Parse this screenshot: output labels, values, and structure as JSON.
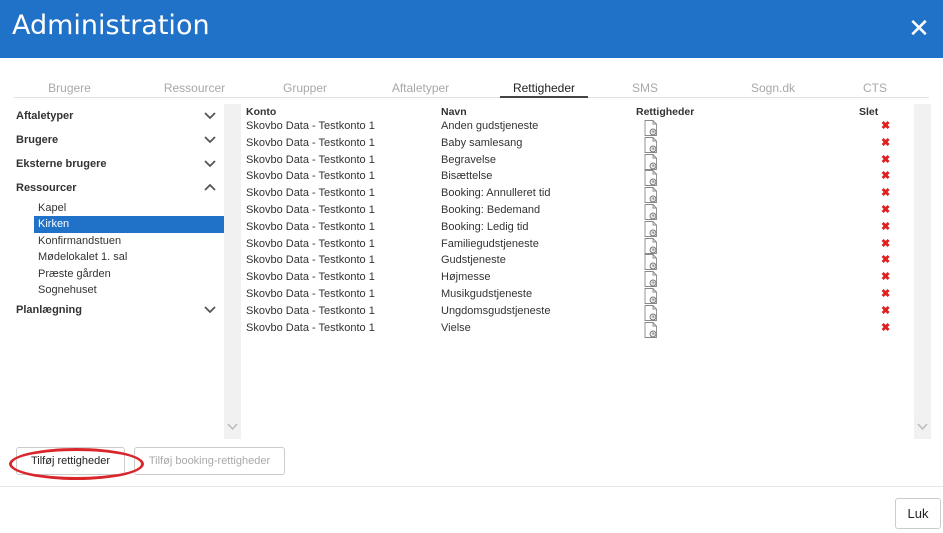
{
  "window": {
    "title": "Administration"
  },
  "tabs": [
    {
      "label": "Brugere",
      "active": false
    },
    {
      "label": "Ressourcer",
      "active": false
    },
    {
      "label": "Grupper",
      "active": false
    },
    {
      "label": "Aftaletyper",
      "active": false
    },
    {
      "label": "Rettigheder",
      "active": true
    },
    {
      "label": "SMS",
      "active": false
    },
    {
      "label": "Sogn.dk",
      "active": false
    },
    {
      "label": "CTS",
      "active": false
    }
  ],
  "sidebar": {
    "groups": [
      {
        "label": "Aftaletyper",
        "expanded": false
      },
      {
        "label": "Brugere",
        "expanded": false
      },
      {
        "label": "Eksterne brugere",
        "expanded": false
      },
      {
        "label": "Ressourcer",
        "expanded": true,
        "items": [
          "Kapel",
          "Kirken",
          "Konfirmandstuen",
          "Mødelokalet 1. sal",
          "Præste gården",
          "Sognehuset"
        ],
        "selected": "Kirken"
      },
      {
        "label": "Planlægning",
        "expanded": false
      }
    ]
  },
  "table": {
    "headers": {
      "konto": "Konto",
      "navn": "Navn",
      "rettigheder": "Rettigheder",
      "slet": "Slet"
    },
    "rows": [
      {
        "konto": "Skovbo Data - Testkonto 1",
        "navn": "Anden gudstjeneste"
      },
      {
        "konto": "Skovbo Data - Testkonto 1",
        "navn": "Baby samlesang"
      },
      {
        "konto": "Skovbo Data - Testkonto 1",
        "navn": "Begravelse"
      },
      {
        "konto": "Skovbo Data - Testkonto 1",
        "navn": "Bisættelse"
      },
      {
        "konto": "Skovbo Data - Testkonto 1",
        "navn": "Booking: Annulleret tid"
      },
      {
        "konto": "Skovbo Data - Testkonto 1",
        "navn": "Booking: Bedemand"
      },
      {
        "konto": "Skovbo Data - Testkonto 1",
        "navn": "Booking: Ledig tid"
      },
      {
        "konto": "Skovbo Data - Testkonto 1",
        "navn": "Familiegudstjeneste"
      },
      {
        "konto": "Skovbo Data - Testkonto 1",
        "navn": "Gudstjeneste"
      },
      {
        "konto": "Skovbo Data - Testkonto 1",
        "navn": "Højmesse"
      },
      {
        "konto": "Skovbo Data - Testkonto 1",
        "navn": "Musikgudstjeneste"
      },
      {
        "konto": "Skovbo Data - Testkonto 1",
        "navn": "Ungdomsgudstjeneste"
      },
      {
        "konto": "Skovbo Data - Testkonto 1",
        "navn": "Vielse"
      }
    ]
  },
  "buttons": {
    "add_rights": "Tilføj rettigheder",
    "add_booking_rights": "Tilføj booking-rettigheder",
    "close": "Luk"
  },
  "icons": {
    "close": "close-icon",
    "chevron_down": "chevron-down-icon",
    "chevron_up": "chevron-up-icon",
    "rights_doc": "document-icon",
    "delete": "delete-icon"
  },
  "colors": {
    "accent": "#1f72c8",
    "delete": "#e02020",
    "highlight_oval": "#d9262a"
  }
}
